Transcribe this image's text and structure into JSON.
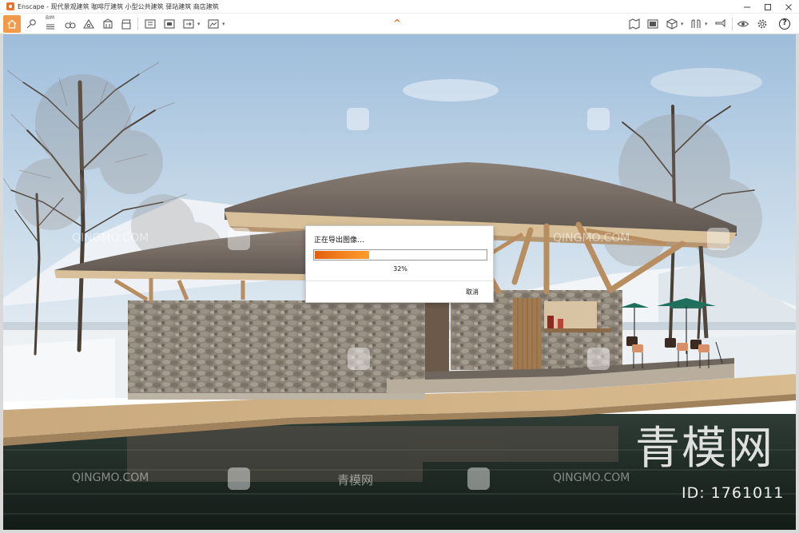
{
  "window": {
    "title": "Enscape - 现代景观建筑 咖啡厅建筑 小型公共建筑 驿站建筑 商店建筑",
    "controls": [
      "minimize",
      "maximize",
      "close"
    ]
  },
  "toolbar": {
    "left_icons": [
      "home-icon",
      "location-pin-icon",
      "bim-icon",
      "binoculars-icon",
      "sun-icon",
      "building-icon",
      "clapper-icon",
      "screenshot-icon",
      "batch-render-icon",
      "export-icon",
      "panorama-icon",
      "standalone-icon"
    ],
    "bim_label": "BIM",
    "right_icons": [
      "map-icon",
      "video-icon",
      "cube-icon",
      "split-view-icon",
      "collaboration-icon",
      "visibility-icon",
      "settings-icon",
      "help-icon"
    ],
    "help_label": "?"
  },
  "dialog": {
    "title": "正在导出图像…",
    "progress": 0.32,
    "progress_label": "32%",
    "cancel_label": "取消"
  },
  "watermarks": {
    "site_text": "QINGMO.COM",
    "site_cn": "青模网",
    "brand_big": "青模网",
    "id_text": "ID: 1761011"
  },
  "colors": {
    "accent": "#f29a4a",
    "progress": "#f4841f",
    "sky_top": "#9cbcdc",
    "sky_bottom": "#dfe9f1"
  }
}
